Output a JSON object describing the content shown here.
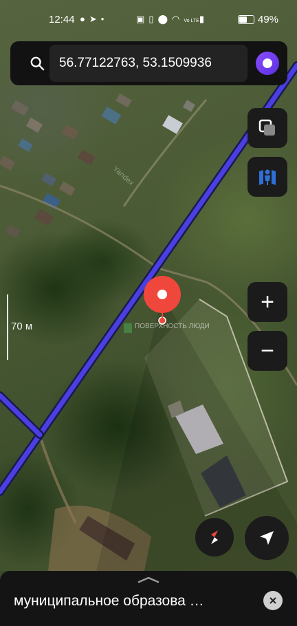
{
  "status_bar": {
    "time": "12:44",
    "left_icons": [
      "chat-bubble-icon",
      "telegram-icon",
      "dot-icon"
    ],
    "right_icons": [
      "nfc-icon",
      "vibrate-icon",
      "location-icon",
      "wifi-icon",
      "volte-icon",
      "signal-icon"
    ],
    "volte_text": "Vo LTE",
    "battery_percent": "49%",
    "battery_level": 0.49
  },
  "search": {
    "query": "56.77122763, 53.1509936",
    "accent": "#7b3ff2"
  },
  "map": {
    "scale_label": "70 м",
    "watermark": "Yandex",
    "poi_label": "ПОВЕРХНОСТЬ ЛЮДИ",
    "route_color": "#4a3fe0",
    "pin_color": "#f0473c"
  },
  "controls": {
    "zoom_in": "+",
    "zoom_out": "−"
  },
  "bottom_sheet": {
    "title": "муниципальное образова …"
  }
}
